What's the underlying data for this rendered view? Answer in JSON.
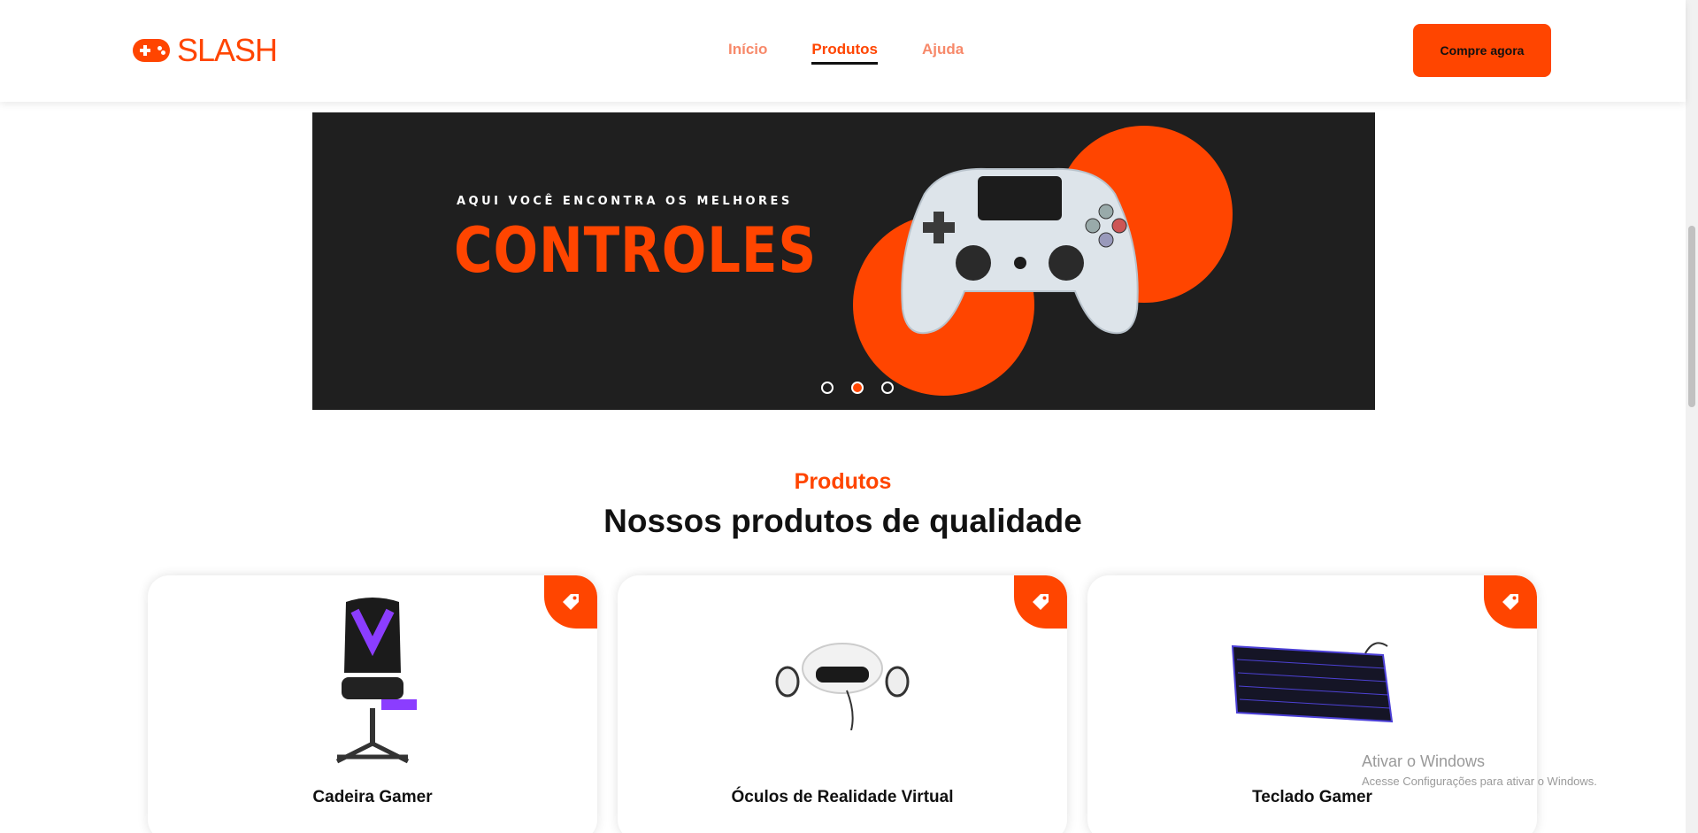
{
  "header": {
    "logo_text": "SLASH",
    "nav": [
      {
        "label": "Início",
        "active": false
      },
      {
        "label": "Produtos",
        "active": true
      },
      {
        "label": "Ajuda",
        "active": false
      }
    ],
    "cta_label": "Compre agora"
  },
  "banner": {
    "subtitle": "AQUI VOCÊ ENCONTRA OS MELHORES",
    "title": "CONTROLES",
    "slides": 3,
    "active_slide": 2
  },
  "products_section": {
    "kicker": "Produtos",
    "title": "Nossos produtos de qualidade",
    "items": [
      {
        "name": "Cadeira Gamer",
        "image": "gaming-chair"
      },
      {
        "name": "Óculos de Realidade Virtual",
        "image": "vr-headset"
      },
      {
        "name": "Teclado Gamer",
        "image": "gaming-keyboard"
      }
    ]
  },
  "windows_watermark": {
    "title": "Ativar o Windows",
    "subtitle": "Acesse Configurações para ativar o Windows."
  },
  "colors": {
    "accent": "#ff4500",
    "banner_bg": "#1f1f1f",
    "nav_inactive": "#f7896a"
  }
}
